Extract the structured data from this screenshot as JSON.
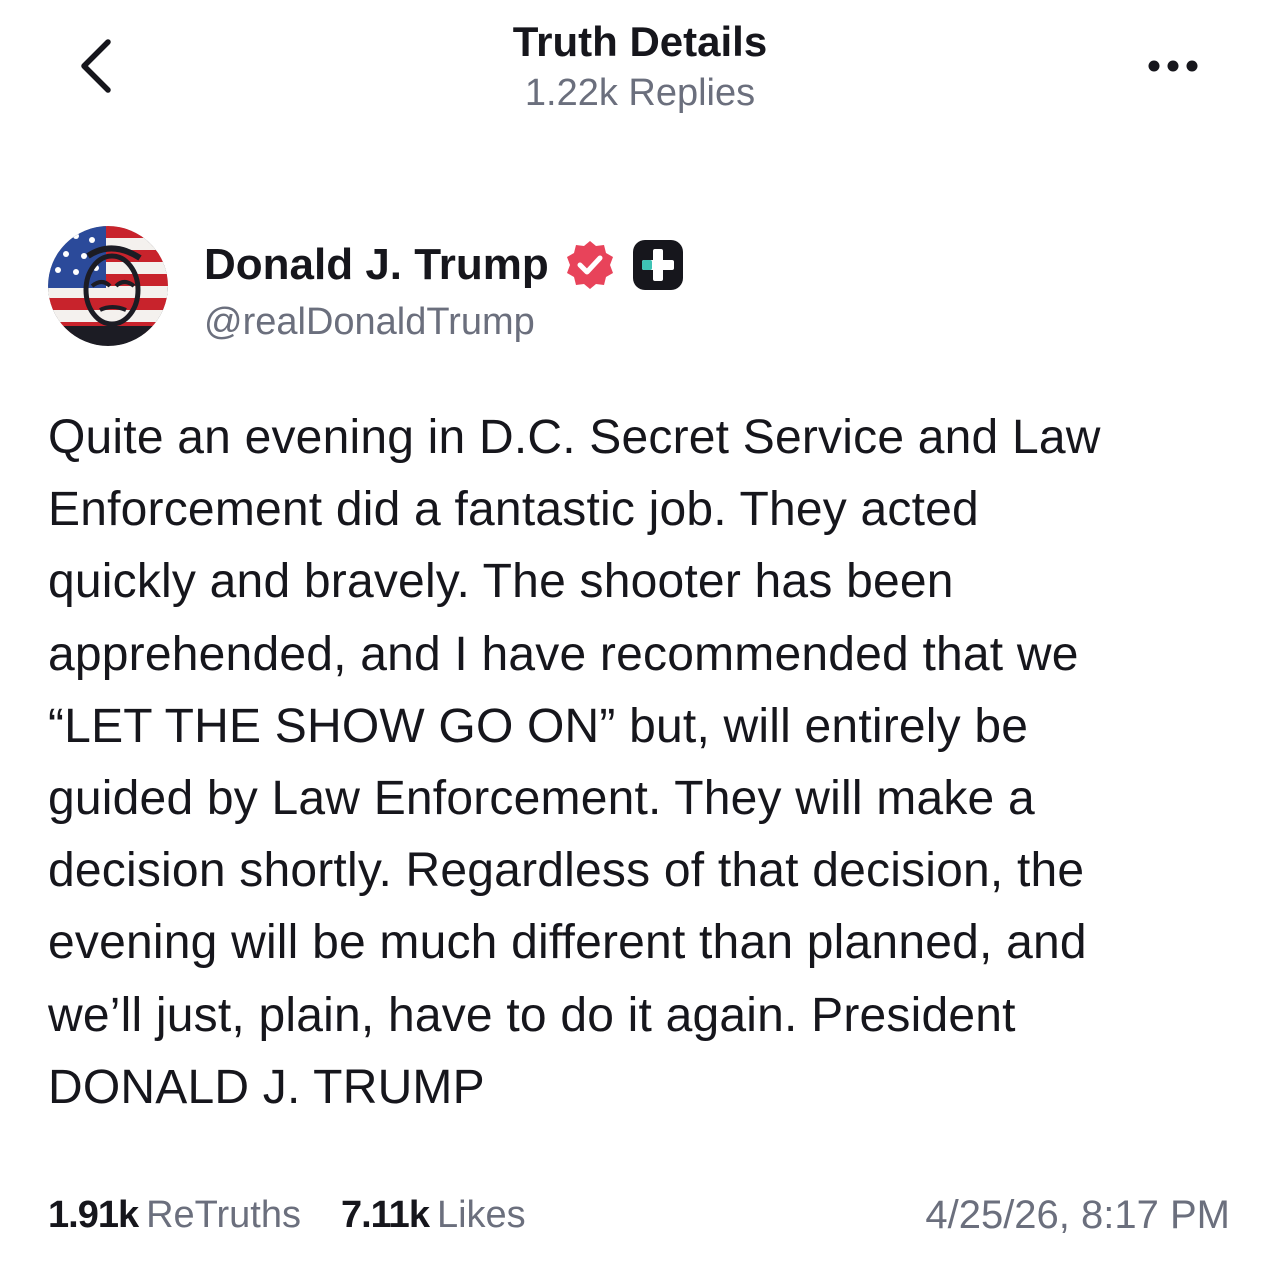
{
  "header": {
    "title": "Truth Details",
    "subtitle": "1.22k Replies",
    "back_icon": "chevron-left-icon",
    "more_icon": "more-horizontal-icon"
  },
  "author": {
    "display_name": "Donald J. Trump",
    "handle": "@realDonaldTrump",
    "verified_color": "#e8435a",
    "badge_icon": "plus-badge-icon"
  },
  "post": {
    "lines": [
      "Quite an evening in D.C. Secret Service and Law",
      "Enforcement did a fantastic job. They acted",
      "quickly and bravely. The shooter has been",
      "apprehended, and I have recommended that we",
      "“LET THE SHOW GO ON” but, will entirely be",
      "guided by Law Enforcement. They will make a",
      "decision shortly. Regardless of that decision, the",
      "evening will be much different than planned, and",
      "we’ll just, plain, have to do it again. President",
      "DONALD J. TRUMP"
    ]
  },
  "stats": {
    "retruths_count": "1.91k",
    "retruths_label": "ReTruths",
    "likes_count": "7.11k",
    "likes_label": "Likes",
    "timestamp": "4/25/26, 8:17 PM"
  }
}
